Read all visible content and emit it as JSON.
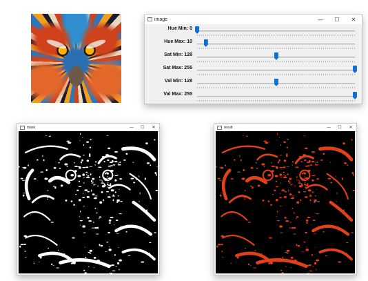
{
  "source_image": {
    "kind": "colorful-mandrill-artwork"
  },
  "control_window": {
    "title": "image",
    "icon": "window-app-icon",
    "buttons": {
      "minimize": "—",
      "maximize": "☐",
      "close": "✕"
    },
    "trackbars": [
      {
        "label": "Hue Min: 0",
        "value": 0,
        "max": 179
      },
      {
        "label": "Hue Max: 10",
        "value": 10,
        "max": 179
      },
      {
        "label": "Sat Min: 128",
        "value": 128,
        "max": 255
      },
      {
        "label": "Sat Max: 255",
        "value": 255,
        "max": 255
      },
      {
        "label": "Val Min: 128",
        "value": 128,
        "max": 255
      },
      {
        "label": "Val Max: 255",
        "value": 255,
        "max": 255
      }
    ]
  },
  "mask_window": {
    "title": "mask",
    "buttons": {
      "minimize": "—",
      "maximize": "☐",
      "close": "✕"
    },
    "foreground": "#ffffff",
    "background": "#000000"
  },
  "result_window": {
    "title": "result",
    "buttons": {
      "minimize": "—",
      "maximize": "☐",
      "close": "✕"
    },
    "foreground": "#e0401a",
    "background": "#000000"
  },
  "colors": {
    "thumb": "#0f6fd6",
    "window_bg": "#f0f0f0"
  }
}
